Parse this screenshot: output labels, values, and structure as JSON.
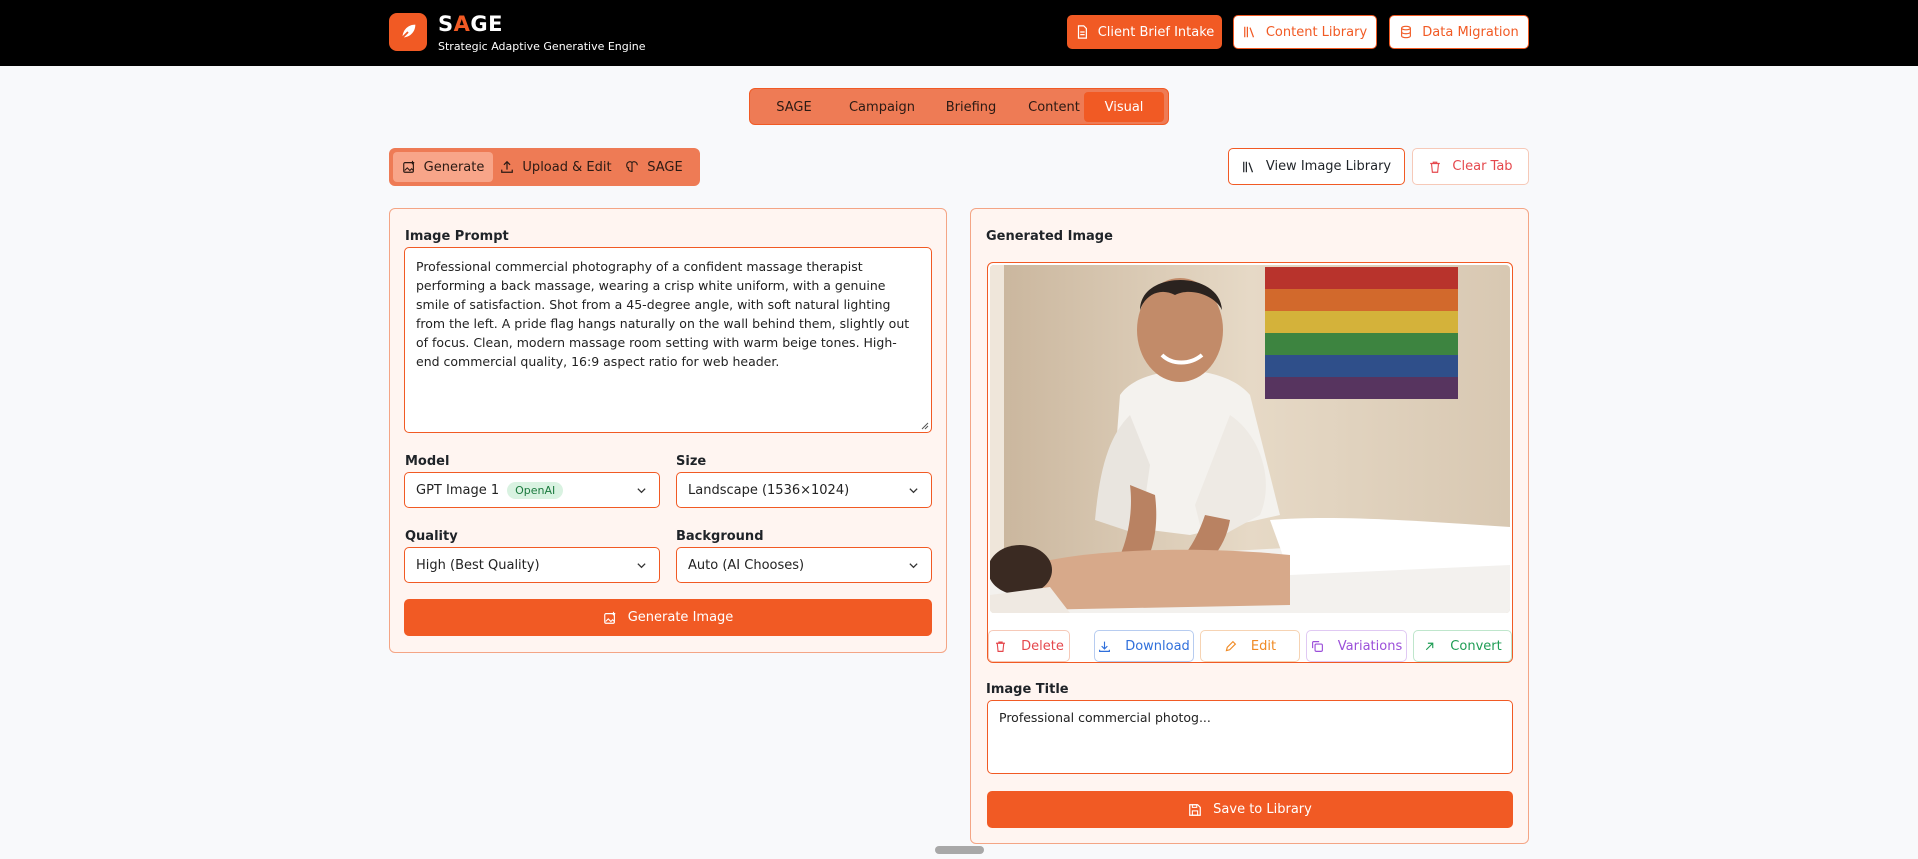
{
  "header": {
    "brand": {
      "title_prefix": "S",
      "title_accent": "A",
      "title_suffix": "GE",
      "subtitle": "Strategic Adaptive Generative Engine"
    },
    "buttons": [
      {
        "label": "Client Brief Intake",
        "icon": "document-icon"
      },
      {
        "label": "Content Library",
        "icon": "library-icon"
      },
      {
        "label": "Data Migration",
        "icon": "database-icon"
      }
    ]
  },
  "main_tabs": [
    "SAGE",
    "Campaign",
    "Briefing",
    "Content",
    "Visual"
  ],
  "active_main_tab": "Visual",
  "sub_tabs": [
    {
      "label": "Generate",
      "icon": "image-plus-icon"
    },
    {
      "label": "Upload & Edit",
      "icon": "upload-icon"
    },
    {
      "label": "SAGE",
      "icon": "brain-icon"
    }
  ],
  "active_sub_tab": "Generate",
  "toolbar": {
    "view_library": "View Image Library",
    "clear_tab": "Clear Tab"
  },
  "form": {
    "prompt_label": "Image Prompt",
    "prompt_value": "Professional commercial photography of a confident massage therapist performing a back massage, wearing a crisp white uniform, with a genuine smile of satisfaction. Shot from a 45-degree angle, with soft natural lighting from the left. A pride flag hangs naturally on the wall behind them, slightly out of focus. Clean, modern massage room setting with warm beige tones. High-end commercial quality, 16:9 aspect ratio for web header.",
    "model_label": "Model",
    "model_value": "GPT Image 1",
    "model_badge": "OpenAI",
    "size_label": "Size",
    "size_value": "Landscape (1536×1024)",
    "quality_label": "Quality",
    "quality_value": "High (Best Quality)",
    "background_label": "Background",
    "background_value": "Auto (AI Chooses)",
    "generate_button": "Generate Image"
  },
  "result": {
    "label": "Generated Image",
    "actions": [
      {
        "label": "Delete",
        "color": "#e5484d",
        "icon": "trash-icon"
      },
      {
        "label": "Download",
        "color": "#2f6fdb",
        "icon": "download-icon"
      },
      {
        "label": "Edit",
        "color": "#f08a24",
        "icon": "pencil-icon"
      },
      {
        "label": "Variations",
        "color": "#9b4fd9",
        "icon": "copy-icon"
      },
      {
        "label": "Convert",
        "color": "#1f9d55",
        "icon": "arrow-up-right-icon"
      }
    ],
    "title_label": "Image Title",
    "title_value": "Professional commercial photog...",
    "save_button": "Save to Library"
  },
  "colors": {
    "accent": "#f15a24",
    "header_bg": "#000000",
    "page_bg": "#f8f9fb"
  }
}
